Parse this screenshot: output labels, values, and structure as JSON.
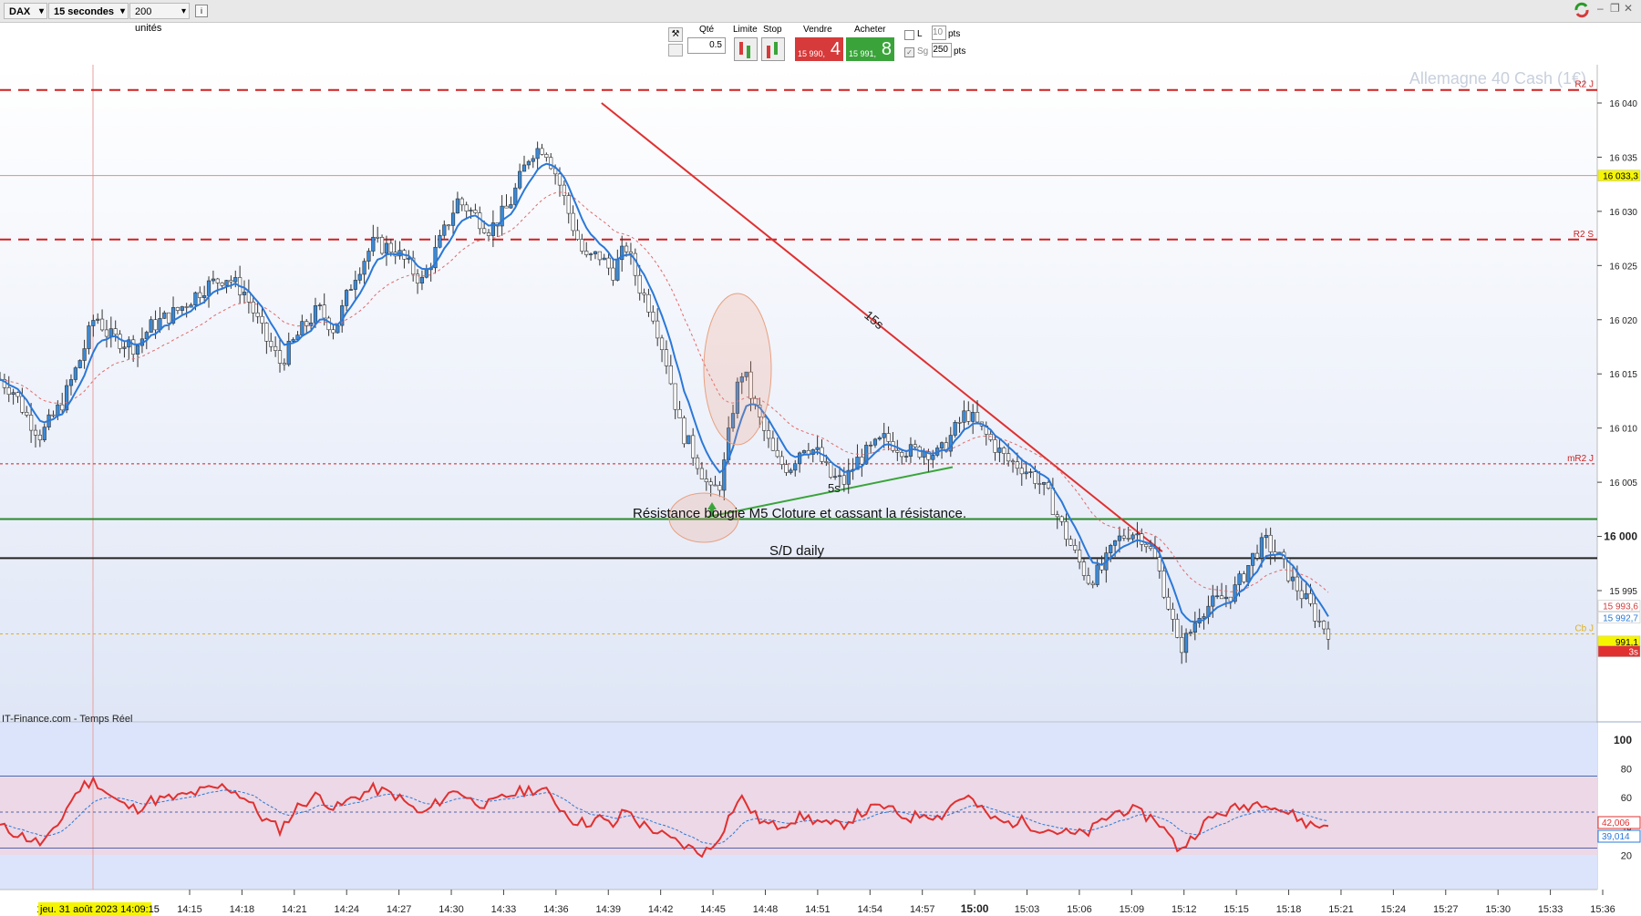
{
  "toolbar": {
    "symbol": "DAX",
    "interval": "15 secondes",
    "units": "200 unités",
    "info_icon": "info-icon",
    "logo_icon": "prorealtime-logo-icon",
    "window_buttons": [
      "minimize-icon",
      "restore-icon",
      "close-icon"
    ]
  },
  "order_panel": {
    "qty_label": "Qté",
    "qty_value": "0.5",
    "limit_label": "Limite",
    "stop_label": "Stop",
    "sell_label": "Vendre",
    "sell_small": "15 990,",
    "sell_big": "4",
    "buy_label": "Acheter",
    "buy_small": "15 991,",
    "buy_big": "8",
    "l_label": "L",
    "pts_value_1": "10",
    "pts_label": "pts",
    "sg_label": "Sg",
    "pts_value_2": "250",
    "sell_color": "#d63a3a",
    "buy_color": "#3aa43a"
  },
  "chart_data": {
    "type": "candlestick",
    "instrument_title": "Allemagne 40 Cash (1€)",
    "x_ticks": [
      "14:15",
      "14:18",
      "14:21",
      "14:24",
      "14:27",
      "14:30",
      "14:33",
      "14:36",
      "14:39",
      "14:42",
      "14:45",
      "14:48",
      "14:51",
      "14:54",
      "14:57",
      "15:00",
      "15:03",
      "15:06",
      "15:09",
      "15:12",
      "15:15",
      "15:18",
      "15:21",
      "15:24",
      "15:27",
      "15:30",
      "15:33",
      "15:36"
    ],
    "date_label": "jeu. 31 août 2023 14:09:15",
    "date_label_prefix": "14",
    "y_ticks": [
      16040,
      16035,
      16030,
      16025,
      16020,
      16015,
      16010,
      16005,
      16000,
      15995
    ],
    "y_tick_labels": [
      "16 040",
      "16 035",
      "16 030",
      "16 025",
      "16 020",
      "16 015",
      "16 010",
      "16 005",
      "16 000",
      "15 995"
    ],
    "y_range": [
      15986.5,
      16041.5
    ],
    "price_path": [
      [
        14.15,
        16014.5
      ],
      [
        14.2,
        16013.4
      ],
      [
        14.25,
        16011.0
      ],
      [
        14.3,
        16009.3
      ],
      [
        14.38,
        16012.4
      ],
      [
        14.45,
        16016.7
      ],
      [
        14.5,
        16020.5
      ],
      [
        14.55,
        16018.5
      ],
      [
        14.65,
        16017.5
      ],
      [
        14.7,
        16019.3
      ],
      [
        14.8,
        16020.8
      ],
      [
        14.9,
        16023.0
      ],
      [
        14.98,
        16024.0
      ],
      [
        15.05,
        16022.5
      ],
      [
        15.12,
        16018.5
      ],
      [
        15.18,
        16016.0
      ],
      [
        15.25,
        16018.8
      ],
      [
        15.32,
        16021.0
      ],
      [
        15.38,
        16019.0
      ],
      [
        15.45,
        16024.0
      ],
      [
        15.52,
        16027.0
      ],
      [
        15.6,
        16026.5
      ],
      [
        15.7,
        16023.5
      ],
      [
        15.78,
        16028.0
      ],
      [
        15.83,
        16031.0
      ],
      [
        15.88,
        16030.0
      ],
      [
        15.95,
        16028.3
      ],
      [
        16.02,
        16030.5
      ],
      [
        16.1,
        16035.5
      ],
      [
        16.15,
        16036.0
      ],
      [
        16.2,
        16033.0
      ],
      [
        16.25,
        16029.0
      ],
      [
        16.3,
        16025.5
      ],
      [
        16.35,
        16026.0
      ],
      [
        16.4,
        16024.3
      ],
      [
        16.45,
        16026.8
      ],
      [
        16.5,
        16023.0
      ],
      [
        16.55,
        16020.5
      ],
      [
        16.6,
        16016.0
      ],
      [
        16.65,
        16010.0
      ],
      [
        16.72,
        16006.5
      ],
      [
        16.76,
        16004.0
      ],
      [
        16.8,
        16005.0
      ],
      [
        16.85,
        16013.0
      ],
      [
        16.88,
        16015.5
      ],
      [
        16.92,
        16012.0
      ],
      [
        16.96,
        16009.5
      ],
      [
        17.0,
        16007.0
      ],
      [
        17.05,
        16006.3
      ],
      [
        17.1,
        16008.5
      ],
      [
        17.15,
        16007.8
      ],
      [
        17.2,
        16005.5
      ],
      [
        17.25,
        16005.0
      ],
      [
        17.3,
        16007.0
      ],
      [
        17.35,
        16008.0
      ],
      [
        17.4,
        16009.0
      ],
      [
        17.45,
        16008.3
      ],
      [
        17.5,
        16007.8
      ],
      [
        17.55,
        16008.0
      ],
      [
        17.6,
        16007.5
      ],
      [
        17.65,
        16009.5
      ],
      [
        17.7,
        16011.5
      ],
      [
        17.75,
        16010.0
      ],
      [
        17.8,
        16008.5
      ],
      [
        17.85,
        16007.0
      ],
      [
        17.9,
        16006.5
      ],
      [
        17.95,
        16005.5
      ],
      [
        18.0,
        16003.8
      ],
      [
        18.05,
        16001.0
      ],
      [
        18.1,
        15998.3
      ],
      [
        18.15,
        15996.0
      ],
      [
        18.2,
        15997.0
      ],
      [
        18.25,
        15999.5
      ],
      [
        18.3,
        16000.5
      ],
      [
        18.35,
        16000.0
      ],
      [
        18.4,
        15997.5
      ],
      [
        18.45,
        15993.0
      ],
      [
        18.48,
        15989.5
      ],
      [
        18.52,
        15991.0
      ],
      [
        18.56,
        15993.2
      ],
      [
        18.62,
        15994.0
      ],
      [
        18.68,
        15994.8
      ],
      [
        18.72,
        15996.5
      ],
      [
        18.76,
        15998.5
      ],
      [
        18.8,
        15999.5
      ],
      [
        18.85,
        15998.0
      ],
      [
        18.9,
        15995.8
      ],
      [
        18.95,
        15994.0
      ],
      [
        19.0,
        15992.0
      ],
      [
        19.03,
        15991.3
      ]
    ],
    "ema_fast_color": "#2a78d8",
    "ema_slow_color": "#e06a6a",
    "horizontal_lines": [
      {
        "label": "R2 J",
        "value": 16041.2,
        "style": "dashed",
        "color": "#d02020"
      },
      {
        "label": "",
        "value": 16033.3,
        "style": "solid-thin",
        "color": "#e28c8c"
      },
      {
        "label": "R2 S",
        "value": 16027.4,
        "style": "dashed",
        "color": "#d02020"
      },
      {
        "label": "mR2 J",
        "value": 16006.7,
        "style": "dotted",
        "color": "#d02020"
      },
      {
        "label": "",
        "value": 16001.6,
        "style": "solid",
        "color": "#2a8a2a"
      },
      {
        "label": "",
        "value": 15998.0,
        "style": "solid",
        "color": "#222222"
      },
      {
        "label": "Cb J",
        "value": 15991.0,
        "style": "dotted",
        "color": "#e0b020"
      }
    ],
    "price_tags": [
      {
        "text": "16 033,3",
        "value": 16033.3,
        "bg": "#f5f500",
        "fg": "#000000"
      },
      {
        "text": "15 993,6",
        "value": 15993.6,
        "bg": "#ffffff",
        "fg": "#d04040"
      },
      {
        "text": "15 992,7",
        "value": 15992.5,
        "bg": "#ffffff",
        "fg": "#2a78d8"
      },
      {
        "text": "991,1",
        "value": 15990.3,
        "bg": "#f5f500",
        "fg": "#000000"
      },
      {
        "text": "3s",
        "value": 15989.4,
        "bg": "#e03030",
        "fg": "#ffffff"
      }
    ],
    "annotations": [
      {
        "text": "15s",
        "type": "trendline-label"
      },
      {
        "text": "Résistance bougie M5 Cloture et cassant la résistance.",
        "type": "text"
      },
      {
        "text": "S/D daily",
        "type": "text"
      },
      {
        "text": "5s",
        "type": "trendline-label"
      }
    ],
    "trendline_15s": {
      "from": [
        16.36,
        16040.0
      ],
      "to": [
        18.42,
        15998.6
      ],
      "color": "#e03030"
    },
    "trendline_5s": {
      "from": [
        16.75,
        16001.8
      ],
      "to": [
        17.65,
        16006.4
      ],
      "color": "#3aa43a"
    },
    "source_label": "IT-Finance.com - Temps Réel",
    "oscillator": {
      "y_ticks": [
        100,
        80,
        60,
        40,
        20
      ],
      "y_range": [
        0,
        100
      ],
      "band_upper": 75,
      "band_mid": 50,
      "band_lower": 25,
      "values_label_1": "42,006",
      "values_label_2": "39,014",
      "line_color": "#e03030",
      "signal_color": "#2a78d8",
      "rsi_path": [
        [
          14.15,
          40
        ],
        [
          14.2,
          36
        ],
        [
          14.25,
          32
        ],
        [
          14.3,
          28
        ],
        [
          14.35,
          36
        ],
        [
          14.4,
          55
        ],
        [
          14.45,
          68
        ],
        [
          14.5,
          72
        ],
        [
          14.55,
          62
        ],
        [
          14.6,
          55
        ],
        [
          14.65,
          52
        ],
        [
          14.7,
          58
        ],
        [
          14.8,
          60
        ],
        [
          14.9,
          65
        ],
        [
          14.98,
          68
        ],
        [
          15.05,
          60
        ],
        [
          15.12,
          45
        ],
        [
          15.18,
          38
        ],
        [
          15.25,
          55
        ],
        [
          15.32,
          62
        ],
        [
          15.38,
          52
        ],
        [
          15.45,
          60
        ],
        [
          15.52,
          66
        ],
        [
          15.6,
          62
        ],
        [
          15.7,
          48
        ],
        [
          15.78,
          60
        ],
        [
          15.83,
          66
        ],
        [
          15.88,
          58
        ],
        [
          15.95,
          55
        ],
        [
          16.02,
          62
        ],
        [
          16.1,
          66
        ],
        [
          16.15,
          65
        ],
        [
          16.2,
          55
        ],
        [
          16.25,
          45
        ],
        [
          16.3,
          42
        ],
        [
          16.35,
          46
        ],
        [
          16.4,
          40
        ],
        [
          16.45,
          52
        ],
        [
          16.5,
          42
        ],
        [
          16.55,
          38
        ],
        [
          16.6,
          32
        ],
        [
          16.65,
          28
        ],
        [
          16.72,
          22
        ],
        [
          16.76,
          24
        ],
        [
          16.8,
          36
        ],
        [
          16.85,
          55
        ],
        [
          16.88,
          60
        ],
        [
          16.92,
          48
        ],
        [
          16.96,
          42
        ],
        [
          17.0,
          40
        ],
        [
          17.05,
          44
        ],
        [
          17.1,
          47
        ],
        [
          17.15,
          44
        ],
        [
          17.2,
          40
        ],
        [
          17.25,
          42
        ],
        [
          17.3,
          48
        ],
        [
          17.35,
          52
        ],
        [
          17.4,
          54
        ],
        [
          17.45,
          48
        ],
        [
          17.5,
          46
        ],
        [
          17.55,
          50
        ],
        [
          17.6,
          46
        ],
        [
          17.65,
          56
        ],
        [
          17.7,
          62
        ],
        [
          17.75,
          52
        ],
        [
          17.8,
          45
        ],
        [
          17.85,
          42
        ],
        [
          17.9,
          44
        ],
        [
          17.95,
          40
        ],
        [
          18.0,
          38
        ],
        [
          18.05,
          36
        ],
        [
          18.1,
          34
        ],
        [
          18.15,
          36
        ],
        [
          18.2,
          44
        ],
        [
          18.25,
          50
        ],
        [
          18.3,
          52
        ],
        [
          18.35,
          48
        ],
        [
          18.4,
          45
        ],
        [
          18.45,
          32
        ],
        [
          18.48,
          24
        ],
        [
          18.52,
          30
        ],
        [
          18.56,
          40
        ],
        [
          18.62,
          48
        ],
        [
          18.68,
          52
        ],
        [
          18.72,
          54
        ],
        [
          18.76,
          56
        ],
        [
          18.8,
          58
        ],
        [
          18.85,
          52
        ],
        [
          18.9,
          48
        ],
        [
          18.95,
          42
        ],
        [
          19.0,
          40
        ],
        [
          19.03,
          42
        ]
      ]
    }
  }
}
